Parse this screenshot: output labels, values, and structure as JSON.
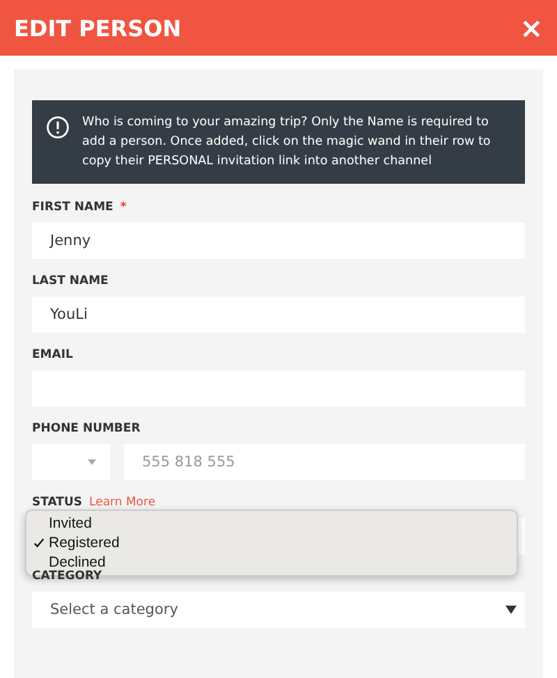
{
  "window": {
    "title": "EDIT PERSON",
    "close": "×"
  },
  "notice": {
    "text": "Who is coming to your amazing trip? Only the Name is required to add a person. Once added, click on the magic wand in their row to copy their PERSONAL invitation link into another channel"
  },
  "fields": [
    {
      "label": "FIRST NAME",
      "required_mark": "*",
      "value": "Jenny"
    },
    {
      "label": "LAST NAME",
      "value": "YouLi"
    },
    {
      "label": "EMAIL"
    }
  ],
  "phone": {
    "label": "PHONE NUMBER",
    "placeholder": "555 818 555"
  },
  "status": {
    "label": "STATUS",
    "link": "Learn More",
    "options": [
      {
        "label": "Invited",
        "selected": false
      },
      {
        "label": "Registered",
        "selected": true
      },
      {
        "label": "Declined",
        "selected": false
      }
    ]
  },
  "category": {
    "label": "CATEGORY",
    "placeholder": "Select a category"
  }
}
